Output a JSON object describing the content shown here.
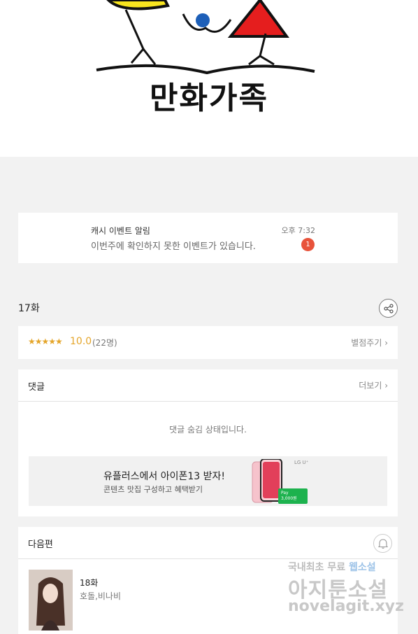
{
  "hero": {
    "logo_text": "만화가족"
  },
  "notification": {
    "title": "캐시 이벤트 알림",
    "time": "오후 7:32",
    "body": "이번주에 확인하지 못한 이벤트가 있습니다.",
    "badge": "1"
  },
  "episode": {
    "title": "17화"
  },
  "rating": {
    "stars": "★★★★★",
    "score": "10.0",
    "votes": "(22명)",
    "rate_label": "별점주기 ›"
  },
  "comments": {
    "title": "댓글",
    "more_label": "더보기 ›",
    "hidden_message": "댓글 숨김 상태입니다."
  },
  "ad": {
    "title": "유플러스에서 아이폰13 받자!",
    "subtitle": "콘텐츠 맛집 구성하고 혜택받기",
    "brand": "LG U⁺",
    "pay_line1": "Pay",
    "pay_line2": "3,000원"
  },
  "next": {
    "title": "다음편",
    "episode": "18화",
    "authors": "호돌,비나비"
  },
  "watermark": {
    "line1_a": "국내최초 무료 ",
    "line1_b": "웹소설",
    "line2": "아지툰소설",
    "line3": "novelagit.xyz"
  },
  "colors": {
    "accent": "#e4a52a",
    "badge": "#e8533b",
    "pay_green": "#1db24e"
  }
}
